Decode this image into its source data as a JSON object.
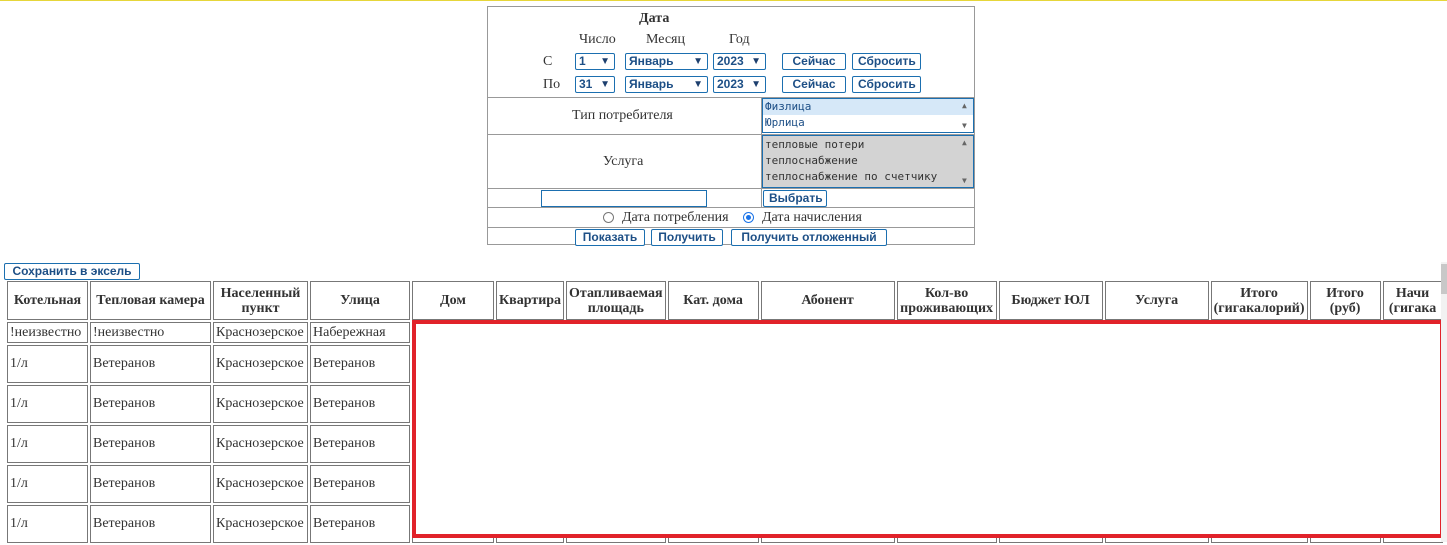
{
  "filter": {
    "date_title": "Дата",
    "col_day": "Число",
    "col_month": "Месяц",
    "col_year": "Год",
    "from_label": "С",
    "to_label": "По",
    "from": {
      "day": "1",
      "month": "Январь",
      "year": "2023"
    },
    "to": {
      "day": "31",
      "month": "Январь",
      "year": "2023"
    },
    "now_button": "Сейчас",
    "reset_button": "Сбросить",
    "consumer_type_label": "Тип потребителя",
    "consumer_types": [
      "Физлица",
      "Юрлица"
    ],
    "service_label": "Услуга",
    "services": [
      "тепловые потери",
      "теплоснабжение",
      "теплоснабжение по счетчику"
    ],
    "search_value": "",
    "choose_button": "Выбрать",
    "radio_consumption": "Дата потребления",
    "radio_accrual": "Дата начисления",
    "selected_radio": "accrual",
    "show_button": "Показать",
    "get_button": "Получить",
    "get_deferred_button": "Получить отложенный"
  },
  "table": {
    "save_excel_button": "Сохранить в эксель",
    "headers": [
      "Котельная",
      "Тепловая камера",
      "Населенный пункт",
      "Улица",
      "Дом",
      "Квартира",
      "Отапливаемая площадь",
      "Кат. дома",
      "Абонент",
      "Кол-во проживающих",
      "Бюджет ЮЛ",
      "Услуга",
      "Итого (гигакалорий)",
      "Итого (руб)",
      "Начи (гигака"
    ],
    "rows": [
      [
        "!неизвестно",
        "!неизвестно",
        "Краснозерское",
        "Набережная"
      ],
      [
        "1/л",
        "Ветеранов",
        "Краснозерское",
        "Ветеранов"
      ],
      [
        "1/л",
        "Ветеранов",
        "Краснозерское",
        "Ветеранов"
      ],
      [
        "1/л",
        "Ветеранов",
        "Краснозерское",
        "Ветеранов"
      ],
      [
        "1/л",
        "Ветеранов",
        "Краснозерское",
        "Ветеранов"
      ],
      [
        "1/л",
        "Ветеранов",
        "Краснозерское",
        "Ветеранов"
      ]
    ]
  },
  "colors": {
    "accent": "#1b6fb0",
    "highlight": "#e1222a",
    "selected_option": "#d6e8f8",
    "listbox_selected": "#d3d3d3"
  }
}
